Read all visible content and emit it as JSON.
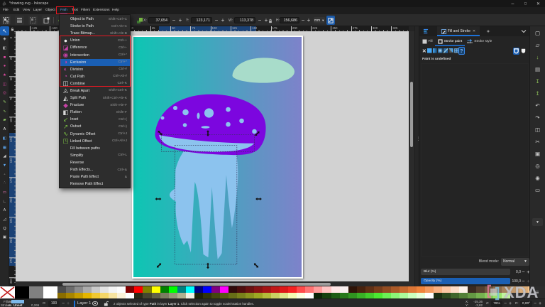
{
  "titlebar": {
    "title": "*drawing.svg - Inkscape",
    "minimize": "–",
    "maximize": "◻",
    "close": "✕"
  },
  "menubar": {
    "items": [
      {
        "label": "File",
        "state": "normal"
      },
      {
        "label": "Edit",
        "state": "normal"
      },
      {
        "label": "View",
        "state": "normal"
      },
      {
        "label": "Layer",
        "state": "normal"
      },
      {
        "label": "Object",
        "state": "normal"
      },
      {
        "label": "Path",
        "state": "active"
      },
      {
        "label": "Text",
        "state": "normal"
      },
      {
        "label": "Filters",
        "state": "normal"
      },
      {
        "label": "Extensions",
        "state": "normal"
      },
      {
        "label": "Help",
        "state": "normal"
      }
    ]
  },
  "toolbar": {
    "x_label": "X:",
    "x_value": "37,654",
    "y_label": "Y:",
    "y_value": "123,171",
    "w_label": "W:",
    "w_value": "113,378",
    "h_label": "H:",
    "h_value": "156,686",
    "minus": "−",
    "plus": "+",
    "unit": "mm",
    "unit_arrow": "▼"
  },
  "path_menu": {
    "items": [
      {
        "label": "Object to Path",
        "shortcut": "Shift+Ctrl+C",
        "glyph": "",
        "color": "#cccccc",
        "state": "normal"
      },
      {
        "label": "Stroke to Path",
        "shortcut": "Ctrl+Alt+C",
        "glyph": "",
        "color": "#cccccc",
        "state": "normal"
      },
      {
        "label": "Trace Bitmap...",
        "shortcut": "Shift+Alt+B",
        "glyph": "",
        "color": "#cccccc",
        "state": "normal"
      },
      {
        "label": "Union",
        "shortcut": "Ctrl++",
        "glyph": "●",
        "color": "#ececec",
        "state": "normal"
      },
      {
        "label": "Difference",
        "shortcut": "Ctrl+-",
        "glyph": "◪",
        "color": "#c541a4",
        "state": "normal"
      },
      {
        "label": "Intersection",
        "shortcut": "Ctrl+*",
        "glyph": "◉",
        "color": "#c541a4",
        "state": "normal"
      },
      {
        "label": "Exclusion",
        "shortcut": "Ctrl+^",
        "glyph": "◑",
        "color": "#c541a4",
        "state": "selected"
      },
      {
        "label": "Division",
        "shortcut": "Ctrl+/",
        "glyph": "◐",
        "color": "#c541a4",
        "state": "normal"
      },
      {
        "label": "Cut Path",
        "shortcut": "Ctrl+Alt+/",
        "glyph": "◔",
        "color": "#c541a4",
        "state": "normal"
      },
      {
        "label": "Combine",
        "shortcut": "Ctrl+K",
        "glyph": "◫",
        "color": "#d8d8d8",
        "state": "normal"
      },
      {
        "label": "Break Apart",
        "shortcut": "Shift+Ctrl+K",
        "glyph": "◬",
        "color": "#d8d8d8",
        "state": "normal"
      },
      {
        "label": "Split Path",
        "shortcut": "Shift+Ctrl+Alt+K",
        "glyph": "◭",
        "color": "#d8d8d8",
        "state": "normal"
      },
      {
        "label": "Fracture",
        "shortcut": "Shift+Alt+F",
        "glyph": "◆",
        "color": "#c541a4",
        "state": "normal"
      },
      {
        "label": "Flatten",
        "shortcut": "Shift+F",
        "glyph": "◧",
        "color": "#d8d8d8",
        "state": "normal"
      },
      {
        "label": "Inset",
        "shortcut": "Ctrl+(",
        "glyph": "↙",
        "color": "#7bc043",
        "state": "normal"
      },
      {
        "label": "Outset",
        "shortcut": "Ctrl+)",
        "glyph": "↗",
        "color": "#7bc043",
        "state": "normal"
      },
      {
        "label": "Dynamic Offset",
        "shortcut": "Ctrl+J",
        "glyph": "∿",
        "color": "#7bc043",
        "state": "normal"
      },
      {
        "label": "Linked Offset",
        "shortcut": "Ctrl+Alt+J",
        "glyph": "◳",
        "color": "#7bc043",
        "state": "normal"
      },
      {
        "label": "Fill between paths",
        "shortcut": "",
        "glyph": "",
        "color": "#cccccc",
        "state": "normal"
      },
      {
        "label": "Simplify",
        "shortcut": "Ctrl+L",
        "glyph": "",
        "color": "#cccccc",
        "state": "normal"
      },
      {
        "label": "Reverse",
        "shortcut": "",
        "glyph": "",
        "color": "#cccccc",
        "state": "normal"
      },
      {
        "label": "Path Effects...",
        "shortcut": "Ctrl+&",
        "glyph": "",
        "color": "#cccccc",
        "state": "normal"
      },
      {
        "label": "Paste Path Effect",
        "shortcut": "&",
        "glyph": "",
        "color": "#cccccc",
        "state": "normal"
      },
      {
        "label": "Remove Path Effect",
        "shortcut": "",
        "glyph": "",
        "color": "#cccccc",
        "state": "normal"
      }
    ]
  },
  "rulers": {
    "h_labels": [
      "-125",
      "-100",
      "-75",
      "-50",
      "-25",
      "0",
      "25",
      "50",
      "75",
      "100",
      "125",
      "150",
      "175",
      "200",
      "225",
      "250",
      "275",
      "300",
      "325"
    ],
    "v_labels": [
      "0",
      "25",
      "50",
      "75",
      "100",
      "125",
      "150",
      "175",
      "200",
      "225",
      "250",
      "275",
      "300"
    ]
  },
  "toolbox": {
    "tools": [
      {
        "name": "selector",
        "glyph": "↖",
        "color": "#ffffff",
        "state": "selected"
      },
      {
        "name": "node-editor",
        "glyph": "◈",
        "color": "#cfcfcf",
        "state": "normal"
      },
      {
        "name": "shape-builder",
        "glyph": "◧",
        "color": "#bdbdbd",
        "state": "normal"
      },
      {
        "name": "rectangle",
        "glyph": "■",
        "color": "#e24aa4",
        "state": "normal"
      },
      {
        "name": "ellipse",
        "glyph": "●",
        "color": "#e24aa4",
        "state": "normal"
      },
      {
        "name": "star",
        "glyph": "★",
        "color": "#e24aa4",
        "state": "normal"
      },
      {
        "name": "box-3d",
        "glyph": "◫",
        "color": "#e24aa4",
        "state": "normal"
      },
      {
        "name": "spiral",
        "glyph": "◎",
        "color": "#e24aa4",
        "state": "normal"
      },
      {
        "name": "pencil",
        "glyph": "✎",
        "color": "#9ad26a",
        "state": "normal"
      },
      {
        "name": "pen",
        "glyph": "∿",
        "color": "#9ad26a",
        "state": "normal"
      },
      {
        "name": "calligraphy",
        "glyph": "▰",
        "color": "#9ad26a",
        "state": "normal"
      },
      {
        "name": "text",
        "glyph": "A",
        "color": "#f0f0f0",
        "state": "normal"
      },
      {
        "name": "gradient",
        "glyph": "◧",
        "color": "#5fa8f0",
        "state": "normal"
      },
      {
        "name": "mesh",
        "glyph": "▦",
        "color": "#5fa8f0",
        "state": "normal"
      },
      {
        "name": "dropper",
        "glyph": "◢",
        "color": "#cfcfcf",
        "state": "normal"
      },
      {
        "name": "paint-bucket",
        "glyph": "▼",
        "color": "#5fa8f0",
        "state": "normal"
      },
      {
        "name": "tweak",
        "glyph": "◦",
        "color": "#cfcfcf",
        "state": "normal"
      },
      {
        "name": "spray",
        "glyph": "∴",
        "color": "#cfcfcf",
        "state": "normal"
      },
      {
        "name": "eraser",
        "glyph": "▭",
        "color": "#e87ab8",
        "state": "normal"
      },
      {
        "name": "connector",
        "glyph": "∟",
        "color": "#cfcfcf",
        "state": "normal"
      },
      {
        "name": "text-a",
        "glyph": "A",
        "color": "#d9d9d9",
        "state": "normal"
      },
      {
        "name": "measure",
        "glyph": "◿",
        "color": "#cfcfcf",
        "state": "normal"
      },
      {
        "name": "zoom",
        "glyph": "Q",
        "color": "#e0e0e0",
        "state": "normal"
      },
      {
        "name": "pages",
        "glyph": "▣",
        "color": "#cfcfcf",
        "state": "normal"
      }
    ]
  },
  "dock": {
    "tab_title": "Fill and Stroke",
    "tab_close": "✕",
    "header_collapse": "⌄",
    "subtabs": [
      {
        "label": "Fill",
        "state": "normal"
      },
      {
        "label": "Stroke paint",
        "state": "active"
      },
      {
        "label": "Stroke style",
        "state": "normal"
      }
    ],
    "paint_message": "Paint is undefined",
    "blend_label": "Blend mode:",
    "blend_value": "Normal",
    "blur_label": "Blur (%)",
    "blur_value": "0,0",
    "opacity_label": "Opacity (%)",
    "opacity_value": "100,0",
    "minus": "−",
    "plus": "+"
  },
  "commands": {
    "items": [
      {
        "name": "new-document",
        "glyph": "▢",
        "color": "#d8d8d8"
      },
      {
        "name": "open",
        "glyph": "▱",
        "color": "#c8c8c8"
      },
      {
        "name": "save",
        "glyph": "↓",
        "color": "#8ec058"
      },
      {
        "name": "print",
        "glyph": "▤",
        "color": "#c8c8c8"
      },
      {
        "name": "import",
        "glyph": "↧",
        "color": "#8ec058"
      },
      {
        "name": "export",
        "glyph": "↥",
        "color": "#8ec058"
      },
      {
        "name": "undo",
        "glyph": "↶",
        "color": "#c8c8c8"
      },
      {
        "name": "redo",
        "glyph": "↷",
        "color": "#c8c8c8"
      },
      {
        "name": "duplicate",
        "glyph": "◫",
        "color": "#c8c8c8"
      },
      {
        "name": "cut",
        "glyph": "✂",
        "color": "#c8c8c8"
      },
      {
        "name": "paste",
        "glyph": "▣",
        "color": "#c8c8c8"
      },
      {
        "name": "zoom-selection",
        "glyph": "◎",
        "color": "#c8c8c8"
      },
      {
        "name": "zoom-drawing",
        "glyph": "◉",
        "color": "#c8c8c8"
      },
      {
        "name": "zoom-page",
        "glyph": "▭",
        "color": "#c8c8c8"
      }
    ],
    "more": "▼"
  },
  "palette": {
    "big": [
      "#000000",
      "#808080",
      "#ffffff"
    ],
    "top": [
      "#4c4c4c",
      "#6c6c6c",
      "#8c8c8c",
      "#ababab",
      "#cacaca",
      "#e3e3e3",
      "#f4f4f4",
      "#fdfdfd",
      "#800000",
      "#ff0000",
      "#808000",
      "#ffff00",
      "#008000",
      "#00ff00",
      "#008080",
      "#00ffff",
      "#000080",
      "#0000ff",
      "#800080",
      "#ff00ff",
      "#300a0a",
      "#4d0d0d",
      "#6a1010",
      "#871212",
      "#a41414",
      "#c11616",
      "#de1818",
      "#f52222",
      "#ff4b4b",
      "#ff7373",
      "#ff9b9b",
      "#ffc3c3",
      "#ffe6e6",
      "#f9f0f0",
      "#2e1408",
      "#47220e",
      "#603015",
      "#793e1b",
      "#924c22",
      "#ab5a28",
      "#c4682e",
      "#dd7635",
      "#f0843b",
      "#f49a5e",
      "#f8b081",
      "#fbc6a4",
      "#fddcc7",
      "#fef2ea",
      "#3a2a20",
      "#55402f",
      "#70563e",
      "#8b6c4d",
      "#a6825c",
      "#c1986b",
      "#dcae7a",
      "#f7c489",
      "#f9d5a9"
    ],
    "bottom": [
      "#8a6d00",
      "#a88500",
      "#c69d00",
      "#e4b500",
      "#f0c830",
      "#f4d668",
      "#f8e4a0",
      "#fbf2d8",
      "#ffffff",
      "#2a2a18",
      "#454530",
      "#606048",
      "#7b7b60",
      "#969678",
      "#b1b190",
      "#f2f2e4",
      "#1f2207",
      "#31350b",
      "#43480f",
      "#555b13",
      "#676e17",
      "#79811b",
      "#8b941f",
      "#9da723",
      "#b3bc3a",
      "#c9d162",
      "#dfe68a",
      "#f5fbb2",
      "#fbffe0",
      "#ffffff",
      "#0c2408",
      "#15400e",
      "#1e5c14",
      "#27781a",
      "#309420",
      "#39b026",
      "#42cc2c",
      "#4be832",
      "#6bf055",
      "#8bf578",
      "#abfa9b",
      "#cbffbe",
      "#e5ffd9",
      "#ffffff",
      "#1c2e14",
      "#2e4a20",
      "#40662c",
      "#527f38",
      "#649844",
      "#76b150",
      "#88ca5c",
      "#9ae368",
      "#c2f0a0"
    ]
  },
  "statusbar": {
    "fill_label": "Fill:",
    "fill_flag": "m",
    "stroke_label": "Stroke:",
    "stroke_flag": "m",
    "stroke_value": "Unset",
    "stroke_width": "0,265",
    "opacity_label": "O:",
    "opacity_value": "100",
    "minus": "−",
    "plus": "+",
    "layer_name": "Layer 1",
    "msg_1": "2 objects selected of type ",
    "msg_bold1": "Path",
    "msg_2": " in layer ",
    "msg_bold2": "Layer 1",
    "msg_3": ". Click selection again to toggle scale/rotation handles.",
    "x_label": "X:",
    "x_value": "-25,36",
    "y_label": "Y:",
    "y_value": "-3,82",
    "z_label": "Z:",
    "z_value": "76%",
    "r_label": "R:",
    "r_value": "0,00°"
  },
  "artwork": {
    "gradient_left": "#0dc6b3",
    "gradient_right": "#7e82ca",
    "blob_color": "#a8dcca",
    "cap_color": "#7c06df",
    "body_color": "#8cc3ee",
    "handle_color": "#111111"
  },
  "watermark": {
    "text": "XDA"
  },
  "icons": {
    "splitter_grip": "⋮",
    "palette_menu": "≡",
    "dropdown_arrow": "▼",
    "paint_none": "✕",
    "paint_unknown": "?"
  }
}
